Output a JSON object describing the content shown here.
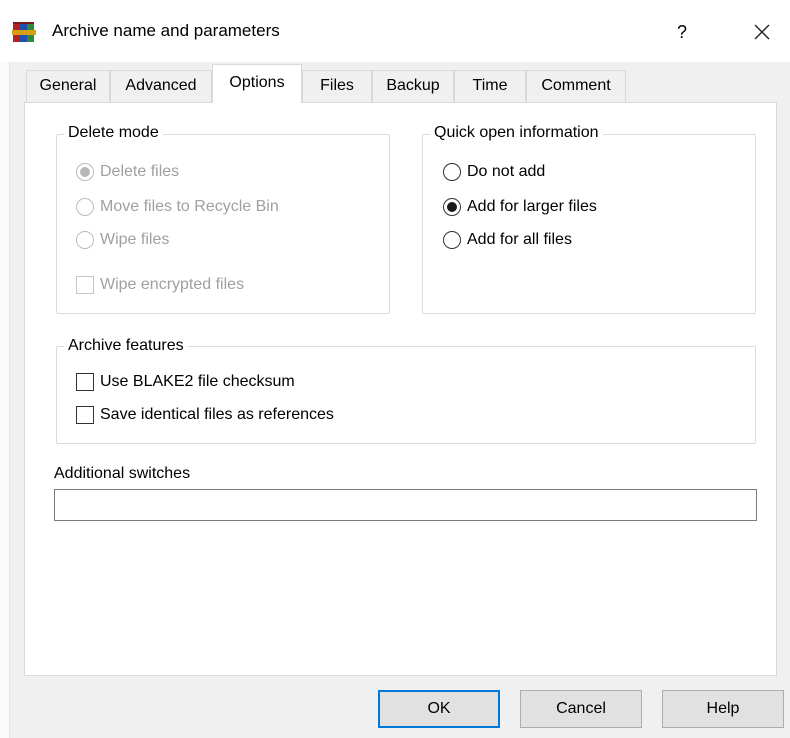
{
  "window": {
    "title": "Archive name and parameters",
    "help_glyph": "?",
    "close_glyph": "✕"
  },
  "tabs": [
    {
      "label": "General",
      "active": false
    },
    {
      "label": "Advanced",
      "active": false
    },
    {
      "label": "Options",
      "active": true
    },
    {
      "label": "Files",
      "active": false
    },
    {
      "label": "Backup",
      "active": false
    },
    {
      "label": "Time",
      "active": false
    },
    {
      "label": "Comment",
      "active": false
    }
  ],
  "delete_mode": {
    "title": "Delete mode",
    "options": [
      {
        "label": "Delete files",
        "selected": true,
        "enabled": false
      },
      {
        "label": "Move files to Recycle Bin",
        "selected": false,
        "enabled": false
      },
      {
        "label": "Wipe files",
        "selected": false,
        "enabled": false
      }
    ],
    "wipe_encrypted": {
      "label": "Wipe encrypted files",
      "checked": false,
      "enabled": false
    }
  },
  "quick_open": {
    "title": "Quick open information",
    "options": [
      {
        "label": "Do not add",
        "selected": false
      },
      {
        "label": "Add for larger files",
        "selected": true
      },
      {
        "label": "Add for all files",
        "selected": false
      }
    ]
  },
  "archive_features": {
    "title": "Archive features",
    "options": [
      {
        "label": "Use BLAKE2 file checksum",
        "checked": false
      },
      {
        "label": "Save identical files as references",
        "checked": false
      }
    ]
  },
  "additional_switches": {
    "label": "Additional switches",
    "value": ""
  },
  "buttons": {
    "ok": "OK",
    "cancel": "Cancel",
    "help": "Help"
  },
  "colors": {
    "dialog_bg": "#f0f0f0",
    "default_button_border": "#0078d7",
    "disabled_text": "#a0a0a0"
  },
  "icons": {
    "app": "winrar-books-icon",
    "close": "close-icon"
  }
}
